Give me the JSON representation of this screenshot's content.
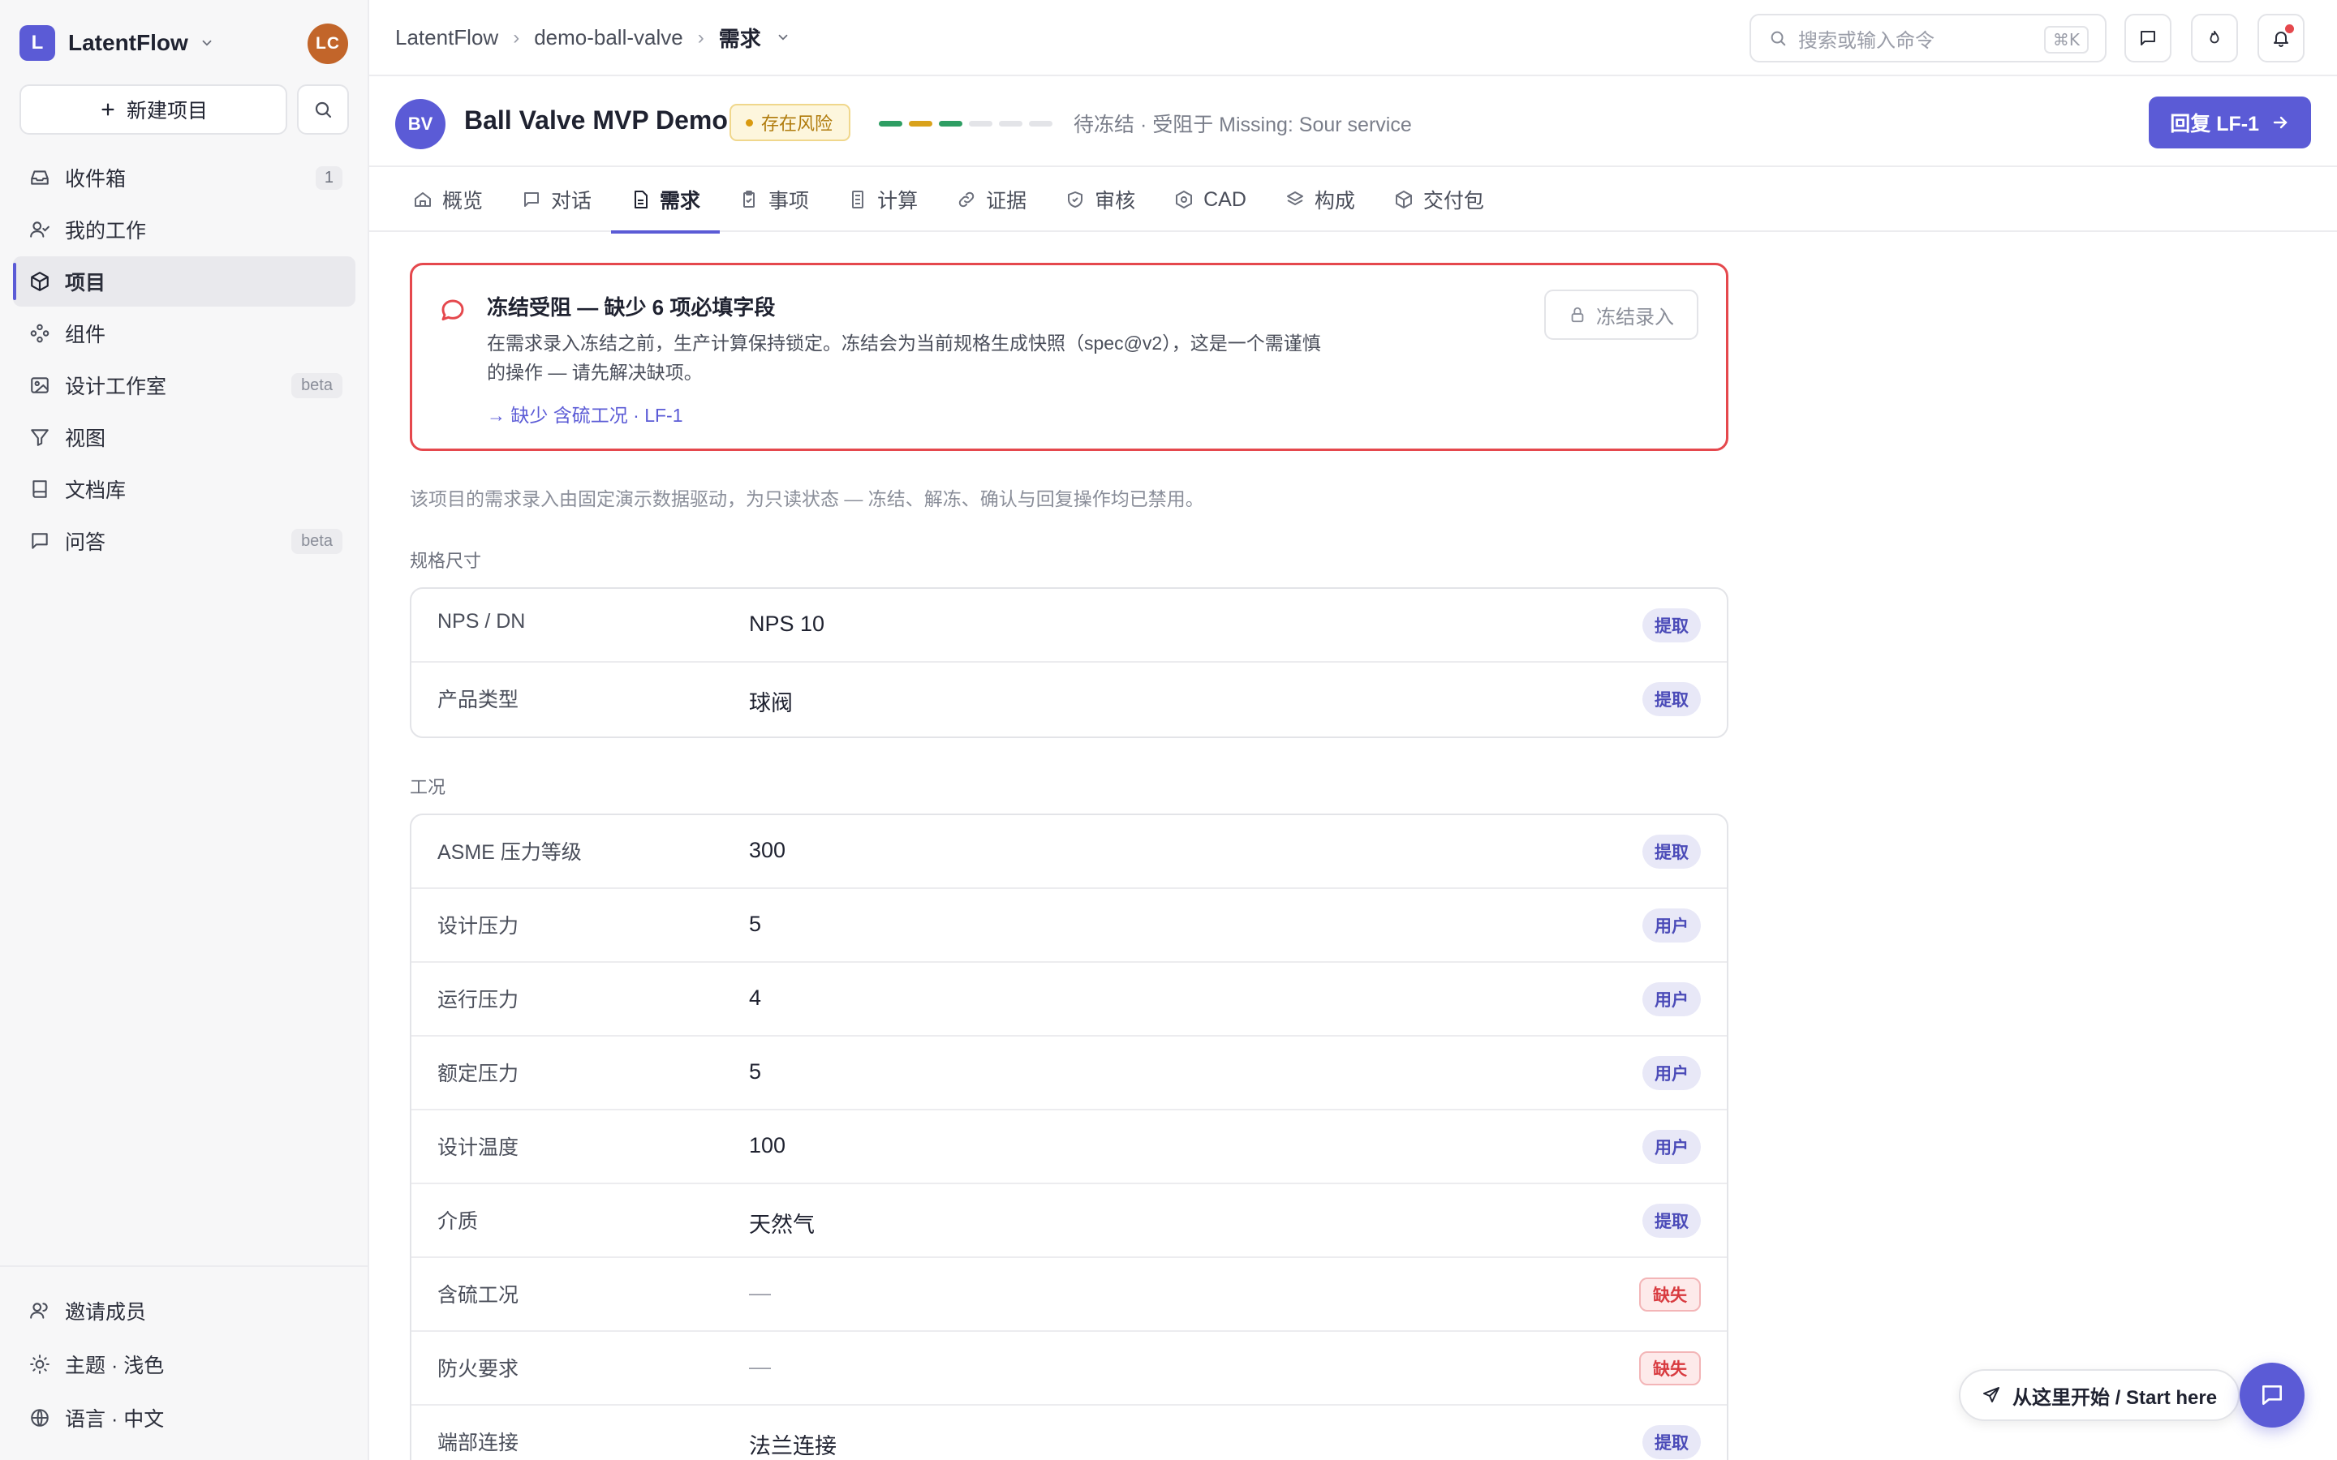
{
  "workspace": {
    "logo_letter": "L",
    "name": "LatentFlow",
    "user_initials": "LC"
  },
  "sidebar": {
    "new_project_label": "新建项目",
    "items": [
      {
        "label": "收件箱",
        "badge": "1",
        "icon": "inbox-icon"
      },
      {
        "label": "我的工作",
        "icon": "user-check-icon"
      },
      {
        "label": "项目",
        "icon": "cube-icon",
        "active": true
      },
      {
        "label": "组件",
        "icon": "components-icon"
      },
      {
        "label": "设计工作室",
        "badge": "beta",
        "icon": "image-icon"
      },
      {
        "label": "视图",
        "icon": "filter-icon"
      },
      {
        "label": "文档库",
        "icon": "book-icon"
      },
      {
        "label": "问答",
        "badge": "beta",
        "icon": "chat-icon"
      }
    ],
    "bottom": [
      {
        "label": "邀请成员",
        "icon": "users-icon"
      },
      {
        "label": "主题 · 浅色",
        "icon": "sun-icon"
      },
      {
        "label": "语言 · 中文",
        "icon": "globe-icon"
      }
    ]
  },
  "topbar": {
    "breadcrumb": [
      "LatentFlow",
      "demo-ball-valve",
      "需求"
    ],
    "separator": "›",
    "search_placeholder": "搜索或输入命令",
    "search_shortcut": "⌘K"
  },
  "project": {
    "avatar": "BV",
    "title": "Ball Valve MVP Demo",
    "risk_badge": "存在风险",
    "stages": [
      "#2e9e63",
      "#d9a21b",
      "#2e9e63",
      "#e3e4e8",
      "#e3e4e8",
      "#e3e4e8"
    ],
    "status_text": "待冻结 · 受阻于 Missing: Sour service",
    "reply_button": "回复 LF-1"
  },
  "tabs": [
    {
      "label": "概览",
      "icon": "home-icon"
    },
    {
      "label": "对话",
      "icon": "message-icon"
    },
    {
      "label": "需求",
      "icon": "document-icon",
      "active": true
    },
    {
      "label": "事项",
      "icon": "clipboard-icon"
    },
    {
      "label": "计算",
      "icon": "calculator-icon"
    },
    {
      "label": "证据",
      "icon": "link-icon"
    },
    {
      "label": "审核",
      "icon": "shield-check-icon"
    },
    {
      "label": "CAD",
      "icon": "hexagon-icon"
    },
    {
      "label": "构成",
      "icon": "layers-icon"
    },
    {
      "label": "交付包",
      "icon": "package-icon"
    }
  ],
  "alert": {
    "title": "冻结受阻 — 缺少 6 项必填字段",
    "body": "在需求录入冻结之前，生产计算保持锁定。冻结会为当前规格生成快照（spec@v2），这是一个需谨慎的操作 — 请先解决缺项。",
    "link": "→ 缺少 含硫工况 · LF-1",
    "freeze_button": "冻结录入"
  },
  "note": "该项目的需求录入由固定演示数据驱动，为只读状态 — 冻结、解冻、确认与回复操作均已禁用。",
  "sections": [
    {
      "label": "规格尺寸",
      "rows": [
        {
          "label": "NPS / DN",
          "value": "NPS 10",
          "tag": "提取",
          "tag_type": "extract"
        },
        {
          "label": "产品类型",
          "value": "球阀",
          "tag": "提取",
          "tag_type": "extract"
        }
      ]
    },
    {
      "label": "工况",
      "rows": [
        {
          "label": "ASME 压力等级",
          "value": "300",
          "tag": "提取",
          "tag_type": "extract"
        },
        {
          "label": "设计压力",
          "value": "5",
          "tag": "用户",
          "tag_type": "user"
        },
        {
          "label": "运行压力",
          "value": "4",
          "tag": "用户",
          "tag_type": "user"
        },
        {
          "label": "额定压力",
          "value": "5",
          "tag": "用户",
          "tag_type": "user"
        },
        {
          "label": "设计温度",
          "value": "100",
          "tag": "用户",
          "tag_type": "user"
        },
        {
          "label": "介质",
          "value": "天然气",
          "tag": "提取",
          "tag_type": "extract"
        },
        {
          "label": "含硫工况",
          "value": "—",
          "tag": "缺失",
          "tag_type": "missing"
        },
        {
          "label": "防火要求",
          "value": "—",
          "tag": "缺失",
          "tag_type": "missing"
        },
        {
          "label": "端部连接",
          "value": "法兰连接",
          "tag": "提取",
          "tag_type": "extract"
        }
      ]
    }
  ],
  "floating": {
    "start_here": "从这里开始 / Start here"
  },
  "colors": {
    "accent": "#5b5bd6",
    "danger": "#e5484d",
    "warning": "#d99a10"
  }
}
